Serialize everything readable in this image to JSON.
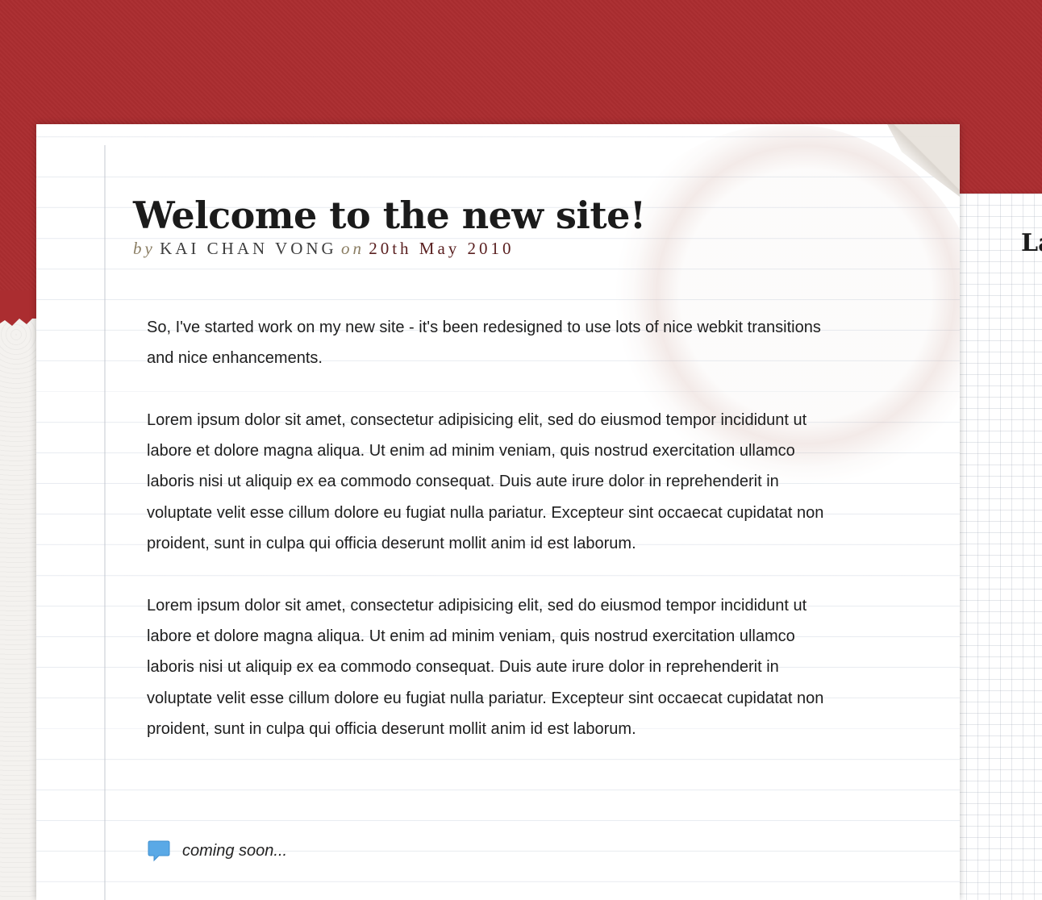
{
  "article": {
    "title": "Welcome to the new site!",
    "byline": {
      "by": "by",
      "author": "KAI CHAN VONG",
      "on": "on",
      "date": "20th May 2010"
    },
    "paragraphs": [
      "So, I've started work on my new site - it's been redesigned to use lots of nice webkit transitions and nice enhancements.",
      "Lorem ipsum dolor sit amet, consectetur adipisicing elit, sed do eiusmod tempor incididunt ut labore et dolore magna aliqua. Ut enim ad minim veniam, quis nostrud exercitation ullamco laboris nisi ut aliquip ex ea commodo consequat. Duis aute irure dolor in reprehenderit in voluptate velit esse cillum dolore eu fugiat nulla pariatur. Excepteur sint occaecat cupidatat non proident, sunt in culpa qui officia deserunt mollit anim id est laborum.",
      "Lorem ipsum dolor sit amet, consectetur adipisicing elit, sed do eiusmod tempor incididunt ut labore et dolore magna aliqua. Ut enim ad minim veniam, quis nostrud exercitation ullamco laboris nisi ut aliquip ex ea commodo consequat. Duis aute irure dolor in reprehenderit in voluptate velit esse cillum dolore eu fugiat nulla pariatur. Excepteur sint occaecat cupidatat non proident, sunt in culpa qui officia deserunt mollit anim id est laborum."
    ],
    "comments": {
      "icon": "speech-bubble-icon",
      "label": "coming soon..."
    }
  },
  "side_card": {
    "title": "La"
  },
  "colors": {
    "background_red": "#ab2d30",
    "paper": "#ffffff",
    "title_text": "#1b1b1b",
    "byline_muted": "#8a7d62",
    "byline_date": "#5a2020",
    "comment_icon": "#5aa9e6"
  }
}
